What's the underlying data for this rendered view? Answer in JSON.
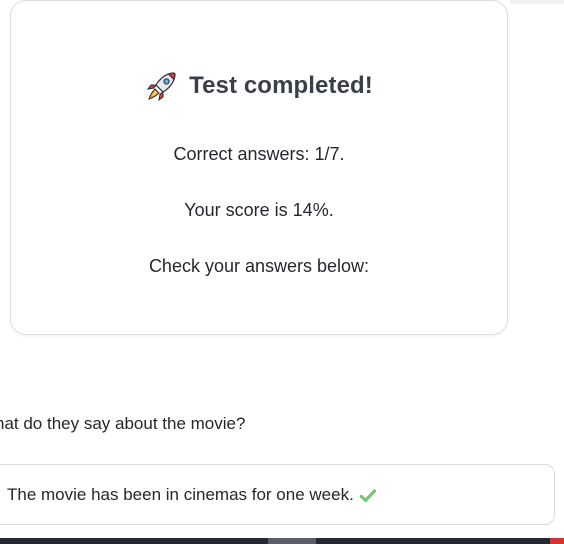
{
  "result": {
    "icon": "rocket-icon",
    "title": "Test completed!",
    "correct_answers": "Correct answers: 1/7.",
    "score": "Your score is 14%.",
    "instruction": "Check your answers below:"
  },
  "question": {
    "text": "hat do they say about the movie?",
    "answer": {
      "text": "The movie has been in cinemas for one week.",
      "status_icon": "checkmark-icon",
      "status_color": "#5cb85c"
    }
  }
}
